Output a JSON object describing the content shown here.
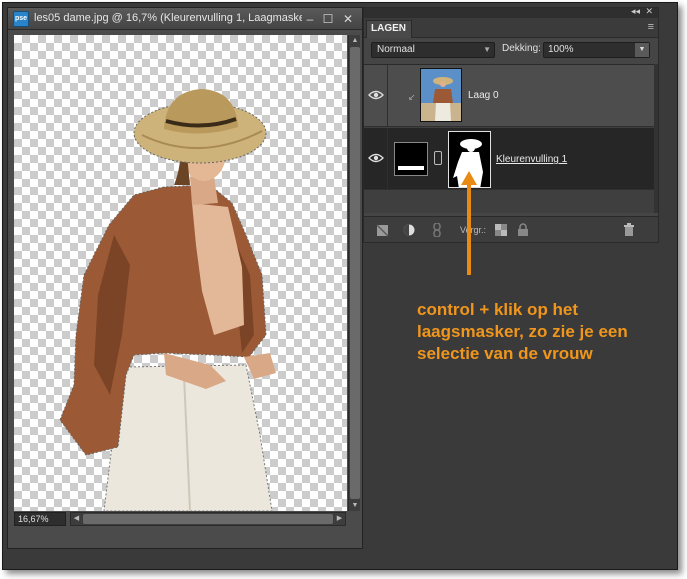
{
  "document": {
    "app_icon_text": "pse",
    "title": "les05 dame.jpg @ 16,7% (Kleurenvulling 1, Laagmasker...",
    "zoom": "16,67%",
    "controls": {
      "minimize": "–",
      "maximize": "☐",
      "close": "✕"
    }
  },
  "layers_panel": {
    "tab": "LAGEN",
    "blend_mode": "Normaal",
    "opacity_label": "Dekking:",
    "opacity_value": "100%",
    "lock_label": "Vergr.:",
    "layers": [
      {
        "name": "Laag 0",
        "visible": true
      },
      {
        "name": "Kleurenvulling 1",
        "visible": true,
        "selected": true
      }
    ]
  },
  "annotation": {
    "text": "control + klik op het laagsmasker, zo zie je een selectie van de vrouw",
    "color": "#f0961c"
  },
  "colors": {
    "accent_orange": "#e98a12",
    "panel_bg": "#454545",
    "selected_layer_bg": "#262626"
  }
}
